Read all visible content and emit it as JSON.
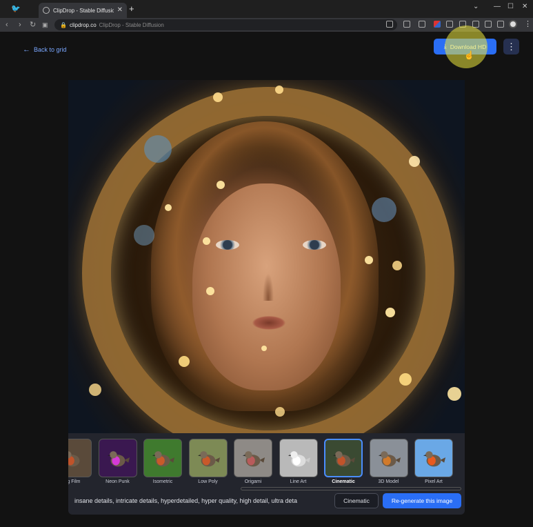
{
  "browser": {
    "tab_title": "ClipDrop - Stable Diffusion",
    "new_tab_symbol": "+",
    "url_domain": "clipdrop.co",
    "url_rest": "ClipDrop - Stable Diffusion"
  },
  "header": {
    "back_label": "Back to grid",
    "download_label": "Download HD",
    "more_symbol": "⋮"
  },
  "styles": [
    {
      "label": "ng Film",
      "selected": false,
      "bg": "#5a4a3a"
    },
    {
      "label": "Neon Punk",
      "selected": false,
      "bg": "#3a1850"
    },
    {
      "label": "Isometric",
      "selected": false,
      "bg": "#3f7a2e"
    },
    {
      "label": "Low Poly",
      "selected": false,
      "bg": "#7d8a55"
    },
    {
      "label": "Origami",
      "selected": false,
      "bg": "#8e8a86"
    },
    {
      "label": "Line Art",
      "selected": false,
      "bg": "#b9b9b9"
    },
    {
      "label": "Cinematic",
      "selected": true,
      "bg": "#3a4a32"
    },
    {
      "label": "3D Model",
      "selected": false,
      "bg": "#8a9098"
    },
    {
      "label": "Pixel Art",
      "selected": false,
      "bg": "#6aa8e6"
    }
  ],
  "prompt": {
    "text": "insane details, intricate details, hyperdetailed, hyper quality, high detail, ultra deta",
    "style_chip": "Cinematic",
    "regenerate_label": "Re-generate this image"
  },
  "colors": {
    "accent": "#2a6ef5",
    "link": "#7aa7ff",
    "panel": "#23252d"
  }
}
